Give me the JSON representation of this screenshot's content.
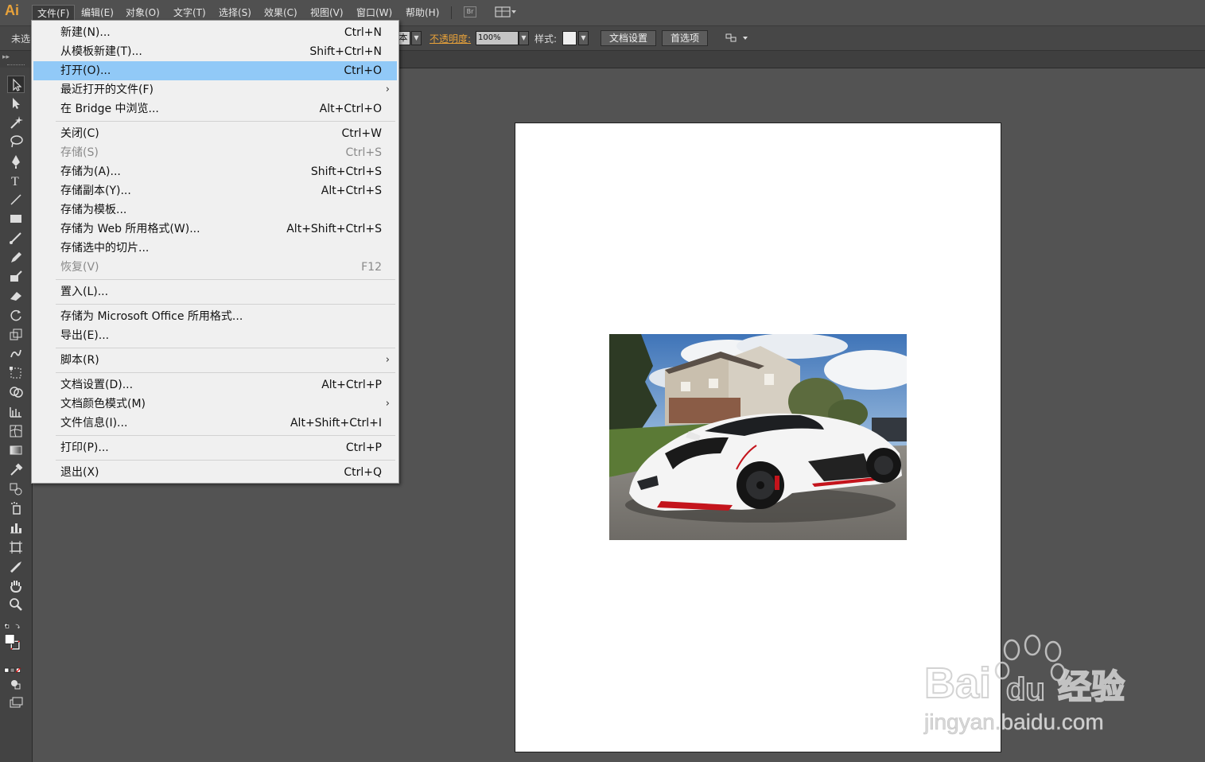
{
  "app": {
    "logo": "Ai"
  },
  "menubar": {
    "items": [
      {
        "label": "文件(F)"
      },
      {
        "label": "编辑(E)"
      },
      {
        "label": "对象(O)"
      },
      {
        "label": "文字(T)"
      },
      {
        "label": "选择(S)"
      },
      {
        "label": "效果(C)"
      },
      {
        "label": "视图(V)"
      },
      {
        "label": "窗口(W)"
      },
      {
        "label": "帮助(H)"
      }
    ],
    "bridge_label": "Br"
  },
  "controlbar": {
    "selection_label": "未选",
    "partial_label": "本",
    "opacity_label": "不透明度:",
    "opacity_value": "100%",
    "style_label": "样式:",
    "doc_setup_button": "文档设置",
    "preferences_button": "首选项"
  },
  "file_menu": {
    "items": [
      {
        "label": "新建(N)...",
        "shortcut": "Ctrl+N"
      },
      {
        "label": "从模板新建(T)...",
        "shortcut": "Shift+Ctrl+N"
      },
      {
        "label": "打开(O)...",
        "shortcut": "Ctrl+O",
        "highlighted": true
      },
      {
        "label": "最近打开的文件(F)",
        "submenu": true
      },
      {
        "label": "在 Bridge 中浏览...",
        "shortcut": "Alt+Ctrl+O"
      },
      {
        "label": "关闭(C)",
        "shortcut": "Ctrl+W"
      },
      {
        "label": "存储(S)",
        "shortcut": "Ctrl+S",
        "disabled": true
      },
      {
        "label": "存储为(A)...",
        "shortcut": "Shift+Ctrl+S"
      },
      {
        "label": "存储副本(Y)...",
        "shortcut": "Alt+Ctrl+S"
      },
      {
        "label": "存储为模板..."
      },
      {
        "label": "存储为 Web 所用格式(W)...",
        "shortcut": "Alt+Shift+Ctrl+S"
      },
      {
        "label": "存储选中的切片..."
      },
      {
        "label": "恢复(V)",
        "shortcut": "F12",
        "disabled": true
      },
      {
        "label": "置入(L)..."
      },
      {
        "label": "存储为 Microsoft Office 所用格式..."
      },
      {
        "label": "导出(E)..."
      },
      {
        "label": "脚本(R)",
        "submenu": true
      },
      {
        "label": "文档设置(D)...",
        "shortcut": "Alt+Ctrl+P"
      },
      {
        "label": "文档颜色模式(M)",
        "submenu": true
      },
      {
        "label": "文件信息(I)...",
        "shortcut": "Alt+Shift+Ctrl+I"
      },
      {
        "label": "打印(P)...",
        "shortcut": "Ctrl+P"
      },
      {
        "label": "退出(X)",
        "shortcut": "Ctrl+Q"
      }
    ]
  },
  "watermark": {
    "brand": "Bai",
    "brand2": "du",
    "product": "经验",
    "url": "jingyan.baidu.com"
  },
  "colors": {
    "accent": "#e8a23a",
    "menu_highlight": "#91c9f7",
    "ui_dark": "#535353"
  }
}
